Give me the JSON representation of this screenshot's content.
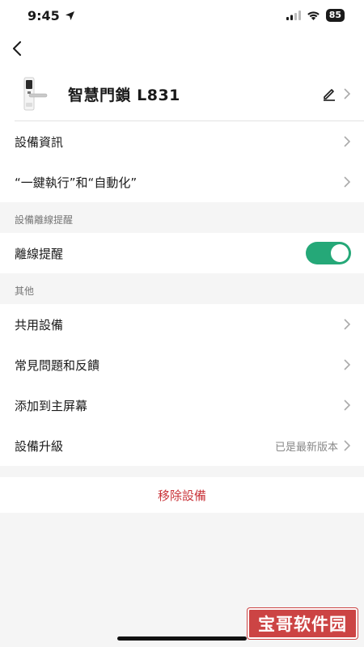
{
  "status_bar": {
    "time": "9:45",
    "battery": "85"
  },
  "device": {
    "name": "智慧門鎖 L831"
  },
  "section1": {
    "items": [
      {
        "label": "設備資訊"
      },
      {
        "label": "“一鍵執行”和“自動化”"
      }
    ]
  },
  "offline_section": {
    "title": "設備離線提醒",
    "toggle_label": "離線提醒",
    "toggle_on": true
  },
  "other_section": {
    "title": "其他",
    "items": [
      {
        "label": "共用設備"
      },
      {
        "label": "常見問題和反饋"
      },
      {
        "label": "添加到主屏幕"
      },
      {
        "label": "設備升級",
        "value": "已是最新版本"
      }
    ]
  },
  "remove": {
    "label": "移除設備"
  },
  "watermark": {
    "text": "宝哥软件园"
  },
  "colors": {
    "accent": "#25a878",
    "danger": "#c9343a"
  }
}
